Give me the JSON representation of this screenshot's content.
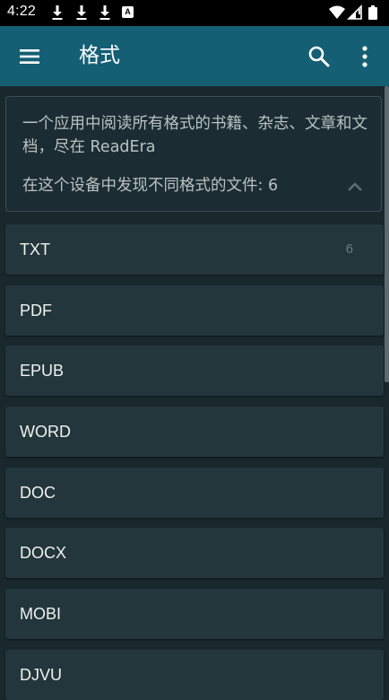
{
  "status_bar": {
    "time": "4:22",
    "icons": [
      "download-icon",
      "download-icon",
      "download-icon",
      "a-badge-icon",
      "wifi-icon",
      "signal-icon",
      "battery-icon"
    ],
    "badge_letter": "A"
  },
  "app_bar": {
    "title": "格式",
    "menu_icon": "hamburger-menu-icon",
    "search_icon": "search-icon",
    "more_icon": "more-vert-icon"
  },
  "info_card": {
    "description": "一个应用中阅读所有格式的书籍、杂志、文章和文档，尽在 ReadEra",
    "count_text": "在这个设备中发现不同格式的文件: 6",
    "collapse_icon": "chevron-up-icon"
  },
  "formats": [
    {
      "label": "TXT",
      "count": "6"
    },
    {
      "label": "PDF",
      "count": ""
    },
    {
      "label": "EPUB",
      "count": ""
    },
    {
      "label": "WORD",
      "count": ""
    },
    {
      "label": "DOC",
      "count": ""
    },
    {
      "label": "DOCX",
      "count": ""
    },
    {
      "label": "MOBI",
      "count": ""
    },
    {
      "label": "DJVU",
      "count": ""
    }
  ],
  "colors": {
    "background": "#18282d",
    "app_bar": "#155f75",
    "card": "#23363c",
    "text_primary": "#eef2f3",
    "text_secondary": "#b9c2c5"
  }
}
